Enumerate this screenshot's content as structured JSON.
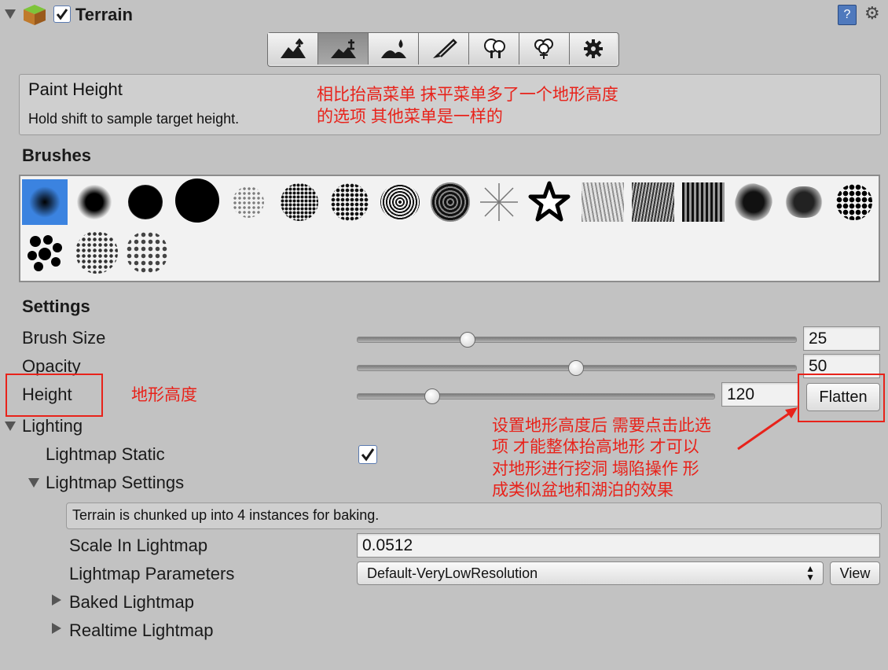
{
  "component": {
    "title": "Terrain",
    "enabled": true
  },
  "toolbar": {
    "tools": [
      "raise-lower-terrain",
      "paint-height",
      "smooth-height",
      "paint-texture",
      "place-trees",
      "paint-details",
      "terrain-settings"
    ],
    "active_index": 1
  },
  "info": {
    "title": "Paint Height",
    "hint": "Hold shift to sample target height."
  },
  "annotations": {
    "note_top_1": "相比抬高菜单 抹平菜单多了一个地形高度",
    "note_top_2": "的选项 其他菜单是一样的",
    "note_height": "地形高度",
    "note_flatten_1": "设置地形高度后 需要点击此选",
    "note_flatten_2": "项 才能整体抬高地形 才可以",
    "note_flatten_3": "对地形进行挖洞 塌陷操作 形",
    "note_flatten_4": "成类似盆地和湖泊的效果"
  },
  "brushes": {
    "heading": "Brushes",
    "count": 20,
    "selected_index": 0
  },
  "settings": {
    "heading": "Settings",
    "brush_size": {
      "label": "Brush Size",
      "value": "25",
      "fraction": 0.25
    },
    "opacity": {
      "label": "Opacity",
      "value": "50",
      "fraction": 0.5
    },
    "height": {
      "label": "Height",
      "value": "120",
      "fraction": 0.2
    },
    "flatten_label": "Flatten"
  },
  "lighting": {
    "heading": "Lighting",
    "lightmap_static": {
      "label": "Lightmap Static",
      "checked": true
    },
    "lightmap_settings": {
      "label": "Lightmap Settings"
    },
    "info": "Terrain is chunked up into 4 instances for baking.",
    "scale": {
      "label": "Scale In Lightmap",
      "value": "0.0512"
    },
    "params": {
      "label": "Lightmap Parameters",
      "value": "Default-VeryLowResolution"
    },
    "view_label": "View",
    "baked": "Baked Lightmap",
    "realtime": "Realtime Lightmap"
  },
  "colors": {
    "annotation": "#e8221a",
    "background": "#c2c2c2",
    "selected_brush": "#3b83e0"
  }
}
